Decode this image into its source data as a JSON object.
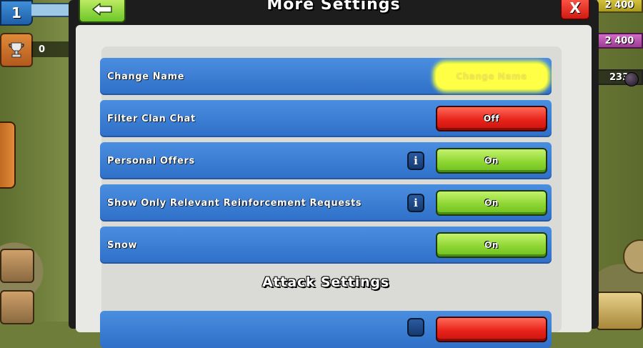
{
  "hud": {
    "level": "1",
    "trophies": "0",
    "gold": "2 400",
    "elixir": "2 400",
    "dark_elixir": "233"
  },
  "modal": {
    "title": "More Settings",
    "close_label": "X"
  },
  "settings": [
    {
      "label": "Change Name",
      "button": "Change Name",
      "state": "highlighted"
    },
    {
      "label": "Filter Clan Chat",
      "button": "Off",
      "state": "off"
    },
    {
      "label": "Personal Offers",
      "button": "On",
      "state": "on",
      "info": true
    },
    {
      "label": "Show Only Relevant Reinforcement Requests",
      "button": "On",
      "state": "on",
      "info": true
    },
    {
      "label": "Snow",
      "button": "On",
      "state": "on"
    }
  ],
  "section": {
    "attack_settings_title": "Attack Settings"
  },
  "info_glyph": "i",
  "colors": {
    "row_blue": "#3a7ed6",
    "on_green": "#8ed633",
    "off_red": "#e8231a",
    "highlight_yellow": "#ffff45"
  }
}
